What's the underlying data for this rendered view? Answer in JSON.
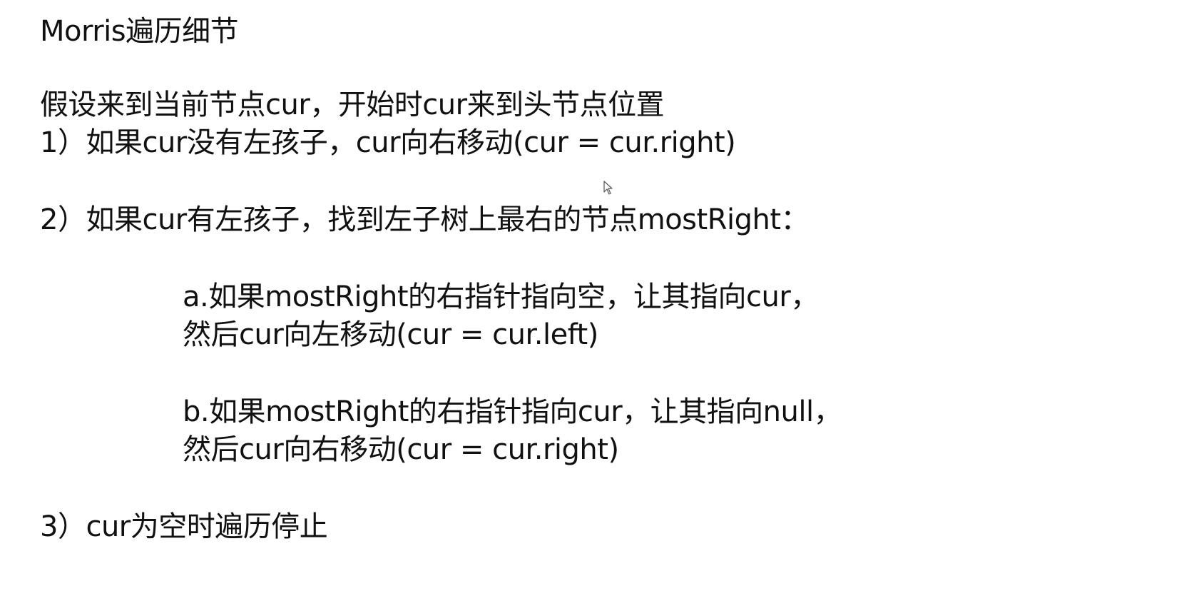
{
  "slide": {
    "title": "Morris遍历细节",
    "intro": "假设来到当前节点cur，开始时cur来到头节点位置",
    "step1": "1）如果cur没有左孩子，cur向右移动(cur = cur.right)",
    "step2": "2）如果cur有左孩子，找到左子树上最右的节点mostRight：",
    "sub_a": {
      "line1": "a.如果mostRight的右指针指向空，让其指向cur，",
      "line2": "然后cur向左移动(cur = cur.left)"
    },
    "sub_b": {
      "line1": "b.如果mostRight的右指针指向cur，让其指向null，",
      "line2": "然后cur向右移动(cur = cur.right)"
    },
    "step3": "3）cur为空时遍历停止"
  },
  "icons": {
    "cursor": "mouse-pointer-icon"
  }
}
